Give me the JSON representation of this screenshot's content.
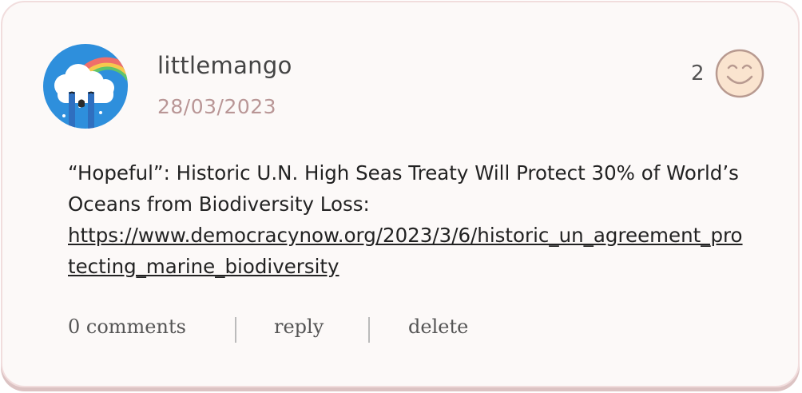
{
  "post": {
    "username": "littlemango",
    "date": "28/03/2023",
    "like_count": "2",
    "text": "“Hopeful”: Historic U.N. High Seas Treaty Will Protect 30% of World’s Oceans from Biodiversity Loss:",
    "link": "https://www.democracynow.org/2023/3/6/historic_un_agreement_protecting_marine_biodiversity"
  },
  "actions": {
    "comments_label": "0 comments",
    "reply_label": "reply",
    "delete_label": "delete"
  },
  "icons": {
    "avatar": "crying-rainbow-cloud-avatar",
    "reaction": "smiley-face-icon"
  },
  "colors": {
    "card_background": "#fcf9f8",
    "card_border": "#f1dddd",
    "date_color": "#b99696",
    "avatar_background": "#2e8fdc",
    "smiley_fill": "#fae4cf",
    "smiley_stroke": "#b89a90"
  }
}
